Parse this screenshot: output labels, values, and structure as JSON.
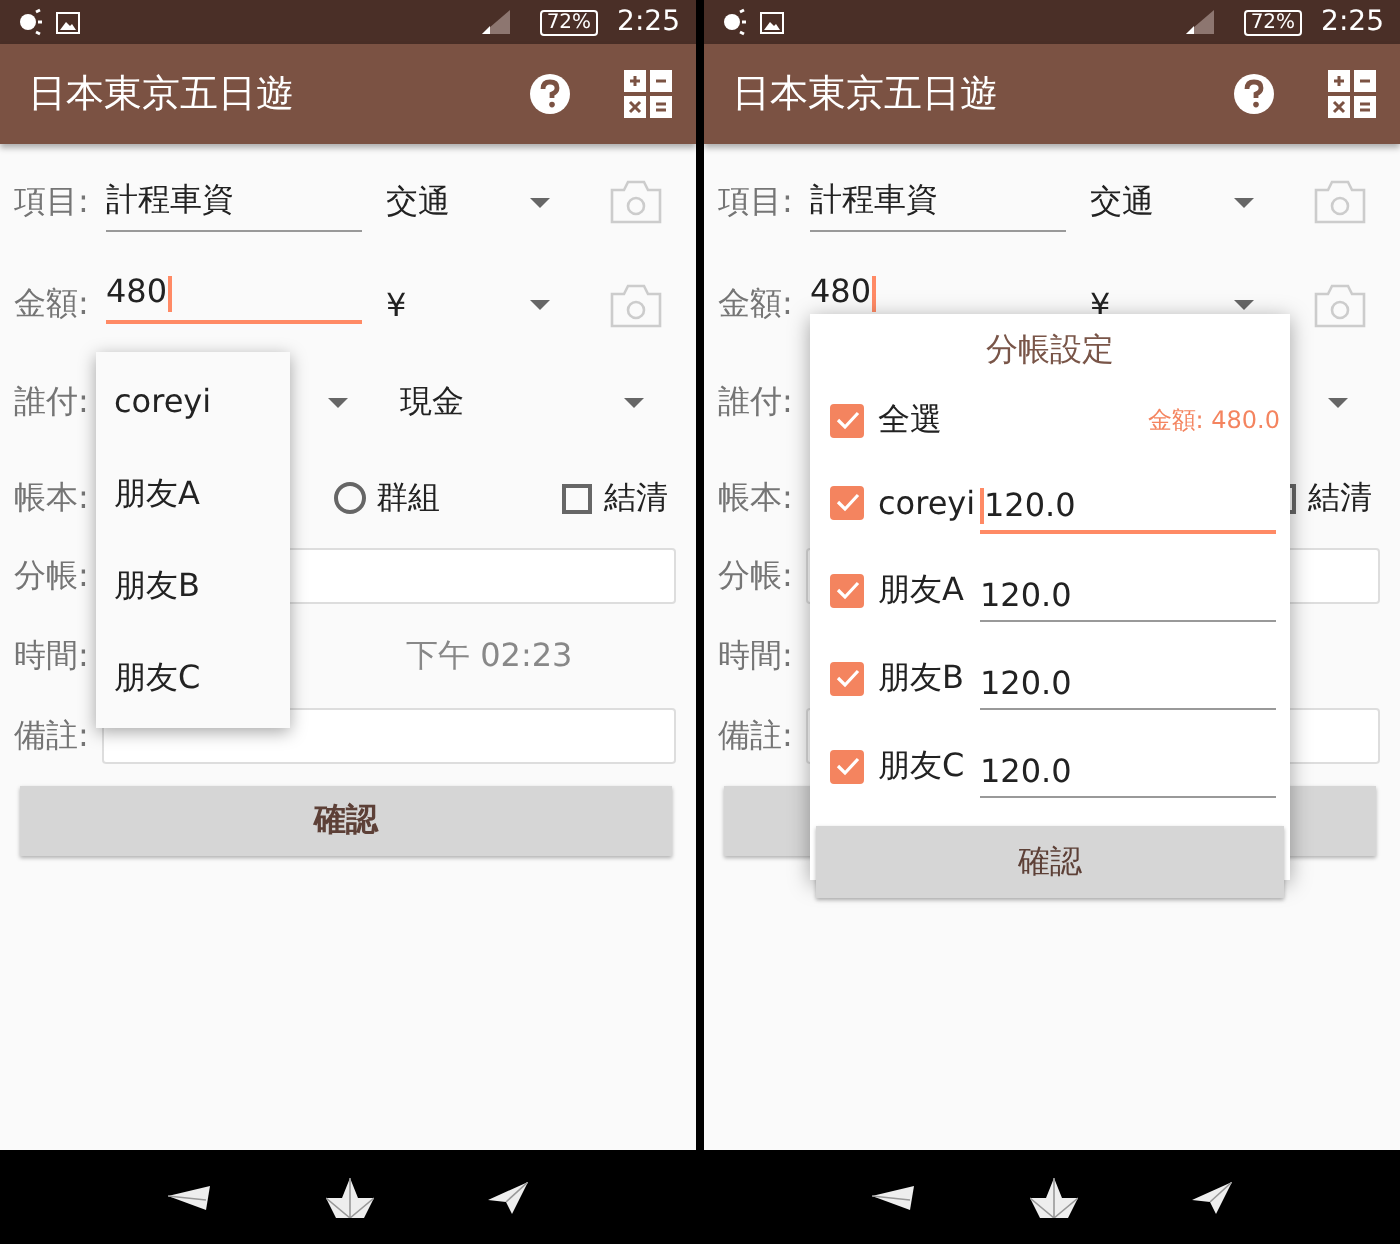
{
  "screens": [
    {
      "status_bar": {
        "battery": "72%",
        "time": "2:25"
      },
      "app_bar": {
        "title": "日本東京五日遊"
      },
      "form": {
        "item": {
          "label": "項目:",
          "value": "計程車資",
          "category": "交通"
        },
        "amount": {
          "label": "金額:",
          "value": "480",
          "focused": true,
          "currency": "¥"
        },
        "payer": {
          "label": "誰付:",
          "method": "現金"
        },
        "book": {
          "label": "帳本:",
          "group": {
            "label": "群組",
            "selected": false
          },
          "settled": {
            "label": "結清",
            "checked": false
          }
        },
        "split": {
          "label": "分帳:"
        },
        "time": {
          "label": "時間:",
          "time": "下午 02:23"
        },
        "note": {
          "label": "備註:"
        },
        "confirm": "確認"
      },
      "overlay": {
        "kind": "dropdown",
        "options": [
          {
            "label": "coreyi"
          },
          {
            "label": "朋友A"
          },
          {
            "label": "朋友B"
          },
          {
            "label": "朋友C"
          }
        ]
      }
    },
    {
      "status_bar": {
        "battery": "72%",
        "time": "2:25"
      },
      "app_bar": {
        "title": "日本東京五日遊"
      },
      "form": {
        "item": {
          "label": "項目:",
          "value": "計程車資",
          "category": "交通"
        },
        "amount": {
          "label": "金額:",
          "value": "480",
          "focused": true,
          "currency": "¥"
        },
        "payer": {
          "label": "誰付:"
        },
        "book": {
          "label": "帳本:",
          "settled": {
            "label": "結清",
            "checked": false
          }
        },
        "split": {
          "label": "分帳:"
        },
        "time": {
          "label": "時間:"
        },
        "note": {
          "label": "備註:"
        }
      },
      "overlay": {
        "kind": "dialog",
        "title": "分帳設定",
        "select_all": {
          "label": "全選",
          "checked": true
        },
        "total": "金額: 480.0",
        "members": [
          {
            "name": "coreyi",
            "checked": true,
            "value": "120.0",
            "focused": true
          },
          {
            "name": "朋友A",
            "checked": true,
            "value": "120.0",
            "focused": false
          },
          {
            "name": "朋友B",
            "checked": true,
            "value": "120.0",
            "focused": false
          },
          {
            "name": "朋友C",
            "checked": true,
            "value": "120.0",
            "focused": false
          }
        ],
        "button": "確認"
      }
    }
  ]
}
